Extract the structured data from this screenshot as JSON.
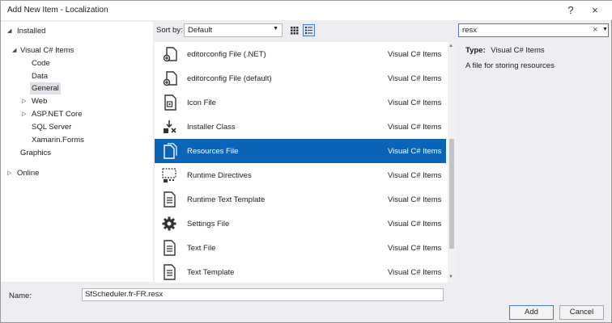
{
  "window": {
    "title": "Add New Item - Localization",
    "help_glyph": "?",
    "close_glyph": "×"
  },
  "tree": {
    "installed": "Installed",
    "visual_cs": "Visual C# Items",
    "code": "Code",
    "data": "Data",
    "general": "General",
    "web": "Web",
    "aspnet": "ASP.NET Core",
    "sql": "SQL Server",
    "xamarin": "Xamarin.Forms",
    "graphics": "Graphics",
    "online": "Online"
  },
  "toolbar": {
    "sort_label": "Sort by:",
    "sort_value": "Default"
  },
  "search": {
    "value": "resx"
  },
  "items": [
    {
      "name": "editorconfig File (.NET)",
      "category": "Visual C# Items",
      "icon": "editorconfig-icon"
    },
    {
      "name": "editorconfig File (default)",
      "category": "Visual C# Items",
      "icon": "editorconfig-icon"
    },
    {
      "name": "Icon File",
      "category": "Visual C# Items",
      "icon": "icon-file-icon"
    },
    {
      "name": "Installer Class",
      "category": "Visual C# Items",
      "icon": "installer-icon"
    },
    {
      "name": "Resources File",
      "category": "Visual C# Items",
      "icon": "resources-icon"
    },
    {
      "name": "Runtime Directives",
      "category": "Visual C# Items",
      "icon": "runtime-directives-icon"
    },
    {
      "name": "Runtime Text Template",
      "category": "Visual C# Items",
      "icon": "text-template-icon"
    },
    {
      "name": "Settings File",
      "category": "Visual C# Items",
      "icon": "gear-icon"
    },
    {
      "name": "Text File",
      "category": "Visual C# Items",
      "icon": "text-file-icon"
    },
    {
      "name": "Text Template",
      "category": "Visual C# Items",
      "icon": "text-template-icon"
    }
  ],
  "selected_item": "Resources File",
  "details": {
    "type_label": "Type:",
    "type_value": "Visual C# Items",
    "description": "A file for storing resources"
  },
  "footer": {
    "name_label": "Name:",
    "name_value": "SfScheduler.fr-FR.resx",
    "add": "Add",
    "cancel": "Cancel"
  }
}
